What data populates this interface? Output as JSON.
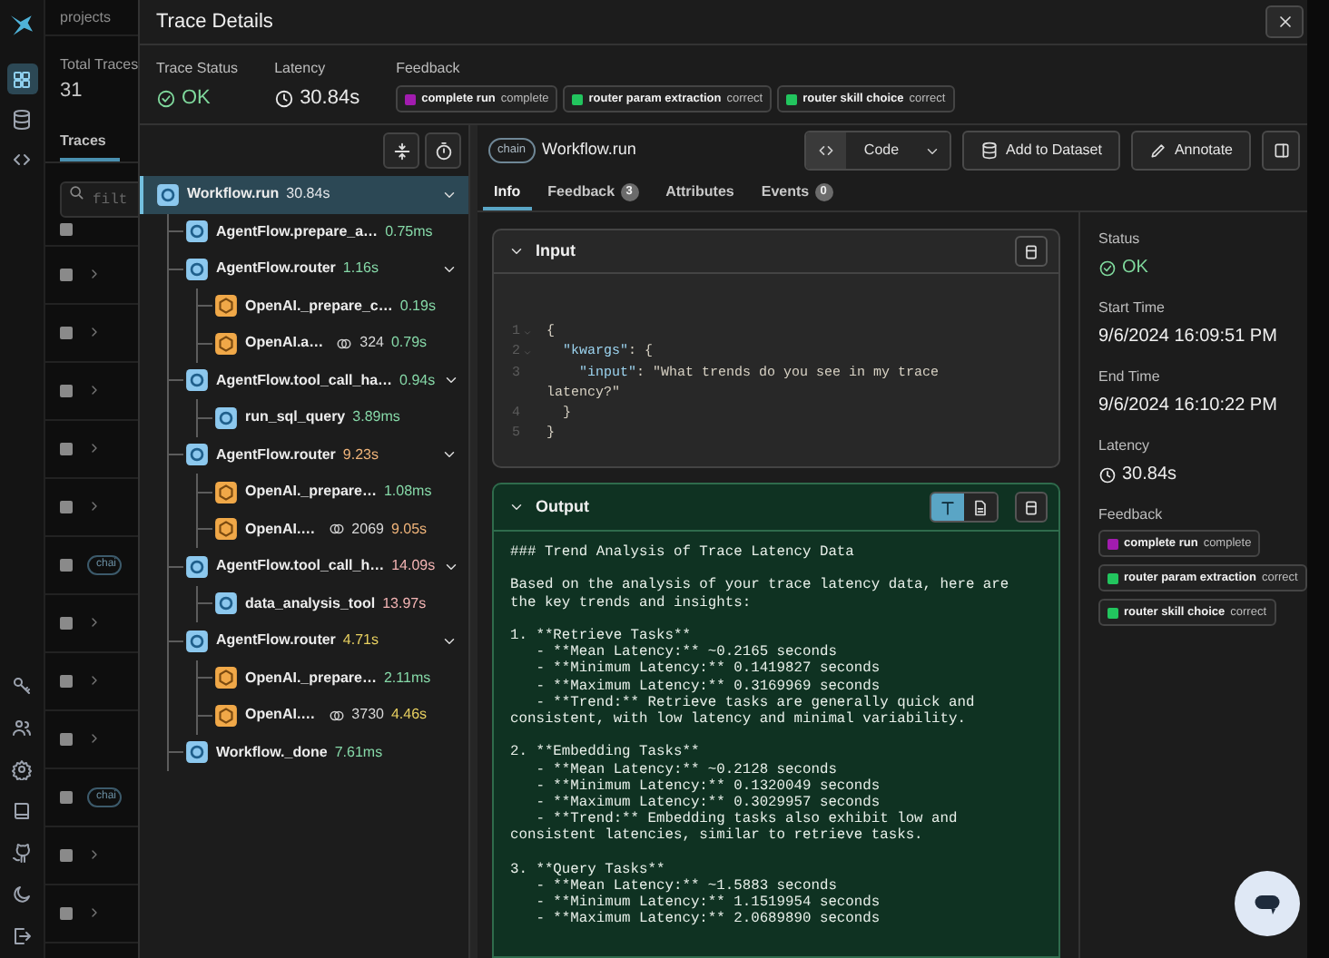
{
  "nav": [
    {
      "selected": true
    },
    {
      "selected": false
    },
    {
      "selected": false
    }
  ],
  "background_app": {
    "breadcrumb": "projects",
    "total_traces": {
      "label": "Total Traces",
      "value": "31"
    },
    "tab": "Traces",
    "search": {
      "placeholder": "filt"
    },
    "header": {
      "checked": false
    },
    "rows": [
      {
        "kind": "span",
        "checked": false
      },
      {
        "kind": "span",
        "checked": false
      },
      {
        "kind": "span",
        "checked": false
      },
      {
        "kind": "span",
        "checked": false
      },
      {
        "kind": "span",
        "checked": false
      },
      {
        "kind": "tag",
        "tag": "chai",
        "checked": false
      },
      {
        "kind": "span",
        "checked": false
      },
      {
        "kind": "span",
        "checked": false
      },
      {
        "kind": "span",
        "checked": false
      },
      {
        "kind": "tag",
        "tag": "chai",
        "checked": false
      },
      {
        "kind": "span",
        "checked": false
      },
      {
        "kind": "span",
        "checked": false
      }
    ]
  },
  "dialog": {
    "title": "Trace Details",
    "summary": {
      "status": {
        "label": "Trace Status",
        "value": "OK"
      },
      "latency": {
        "label": "Latency",
        "value": "30.84s"
      },
      "feedback": {
        "label": "Feedback",
        "items": [
          {
            "name": "complete run",
            "value": "complete",
            "color": "#a21caf"
          },
          {
            "name": "router param extraction",
            "value": "correct",
            "color": "#22c55e"
          },
          {
            "name": "router skill choice",
            "value": "correct",
            "color": "#22c55e"
          }
        ]
      }
    },
    "tree": {
      "spans": [
        {
          "kind": "chain",
          "name": "Workflow.run",
          "latency": "30.84s",
          "color": "#e5e7eb",
          "selected": true,
          "expanded": true,
          "children": [
            {
              "kind": "chain",
              "name": "AgentFlow.prepare_a…",
              "latency": "0.75ms",
              "color": "#86d9a8",
              "selected": false
            },
            {
              "kind": "chain",
              "name": "AgentFlow.router",
              "latency": "1.16s",
              "color": "#86d9a8",
              "selected": false,
              "expanded": true,
              "children": [
                {
                  "kind": "llm",
                  "name": "OpenAI._prepare_c…",
                  "latency": "0.19s",
                  "color": "#86d9a8",
                  "selected": false
                },
                {
                  "kind": "llm",
                  "name": "OpenAI.a…",
                  "tokens": "324",
                  "latency": "0.79s",
                  "color": "#86d9a8",
                  "selected": false
                }
              ]
            },
            {
              "kind": "chain",
              "name": "AgentFlow.tool_call_ha…",
              "latency": "0.94s",
              "color": "#86d9a8",
              "selected": false,
              "expanded": true,
              "children": [
                {
                  "kind": "tool",
                  "name": "run_sql_query",
                  "latency": "3.89ms",
                  "color": "#86d9a8",
                  "selected": false
                }
              ]
            },
            {
              "kind": "chain",
              "name": "AgentFlow.router",
              "latency": "9.23s",
              "color": "#f0b47a",
              "selected": false,
              "expanded": true,
              "children": [
                {
                  "kind": "llm",
                  "name": "OpenAI._prepare…",
                  "latency": "1.08ms",
                  "color": "#86d9a8",
                  "selected": false
                },
                {
                  "kind": "llm",
                  "name": "OpenAI.…",
                  "tokens": "2069",
                  "latency": "9.05s",
                  "color": "#f0b47a",
                  "selected": false
                }
              ]
            },
            {
              "kind": "chain",
              "name": "AgentFlow.tool_call_h…",
              "latency": "14.09s",
              "color": "#f4b4b4",
              "selected": false,
              "expanded": true,
              "children": [
                {
                  "kind": "tool",
                  "name": "data_analysis_tool",
                  "latency": "13.97s",
                  "color": "#f4b4b4",
                  "selected": false
                }
              ]
            },
            {
              "kind": "chain",
              "name": "AgentFlow.router",
              "latency": "4.71s",
              "color": "#e8d060",
              "selected": false,
              "expanded": true,
              "children": [
                {
                  "kind": "llm",
                  "name": "OpenAI._prepare…",
                  "latency": "2.11ms",
                  "color": "#86d9a8",
                  "selected": false
                },
                {
                  "kind": "llm",
                  "name": "OpenAI.…",
                  "tokens": "3730",
                  "latency": "4.46s",
                  "color": "#e8d060",
                  "selected": false
                }
              ]
            },
            {
              "kind": "chain",
              "name": "Workflow._done",
              "latency": "7.61ms",
              "color": "#86d9a8",
              "selected": false
            }
          ]
        }
      ]
    },
    "span_detail": {
      "kind_label": "chain",
      "name": "Workflow.run",
      "view_mode": "Code",
      "actions": [
        {
          "kind": "dataset",
          "label": "Add to Dataset"
        },
        {
          "kind": "annotate",
          "label": "Annotate"
        }
      ],
      "tabs": [
        {
          "label": "Info",
          "selected": true
        },
        {
          "label": "Feedback",
          "count": "3",
          "selected": false
        },
        {
          "label": "Attributes",
          "selected": false
        },
        {
          "label": "Events",
          "count": "0",
          "selected": false
        }
      ],
      "input": {
        "title": "Input",
        "expanded": true,
        "lines": [
          {
            "number": "1",
            "fold": true,
            "text": "{"
          },
          {
            "number": "2",
            "fold": true,
            "text": "  \"kwargs\": {"
          },
          {
            "number": "3",
            "fold": false,
            "text": "    \"input\": \"What trends do you see in my trace"
          },
          {
            "text": "latency?\""
          },
          {
            "number": "4",
            "fold": false,
            "text": "  }"
          },
          {
            "number": "5",
            "fold": false,
            "text": "}"
          }
        ]
      },
      "output": {
        "title": "Output",
        "expanded": true,
        "modes": [
          {
            "kind": "text",
            "selected": true
          },
          {
            "kind": "document",
            "selected": false
          }
        ],
        "paragraphs": [
          [
            "### Trend Analysis of Trace Latency Data"
          ],
          [
            "Based on the analysis of your trace latency data, here are",
            "the key trends and insights:"
          ],
          [
            "1. **Retrieve Tasks**",
            "   - **Mean Latency:** ~0.2165 seconds",
            "   - **Minimum Latency:** 0.1419827 seconds",
            "   - **Maximum Latency:** 0.3169969 seconds",
            "   - **Trend:** Retrieve tasks are generally quick and",
            "consistent, with low latency and minimal variability."
          ],
          [
            "2. **Embedding Tasks**",
            "   - **Mean Latency:** ~0.2128 seconds",
            "   - **Minimum Latency:** 0.1320049 seconds",
            "   - **Maximum Latency:** 0.3029957 seconds",
            "   - **Trend:** Embedding tasks also exhibit low and",
            "consistent latencies, similar to retrieve tasks."
          ],
          [
            "3. **Query Tasks**",
            "   - **Mean Latency:** ~1.5883 seconds",
            "   - **Minimum Latency:** 1.1519954 seconds",
            "   - **Maximum Latency:** 2.0689890 seconds"
          ]
        ]
      },
      "info": {
        "status": {
          "label": "Status",
          "value": "OK"
        },
        "start_time": {
          "label": "Start Time",
          "value": "9/6/2024 16:09:51 PM"
        },
        "end_time": {
          "label": "End Time",
          "value": "9/6/2024 16:10:22 PM"
        },
        "latency": {
          "label": "Latency",
          "value": "30.84s"
        },
        "feedback": {
          "label": "Feedback",
          "items": [
            {
              "name": "complete run",
              "value": "complete",
              "color": "#a21caf"
            },
            {
              "name": "router param extraction",
              "value": "correct",
              "color": "#22c55e"
            },
            {
              "name": "router skill choice",
              "value": "correct",
              "color": "#22c55e"
            }
          ]
        }
      }
    }
  }
}
